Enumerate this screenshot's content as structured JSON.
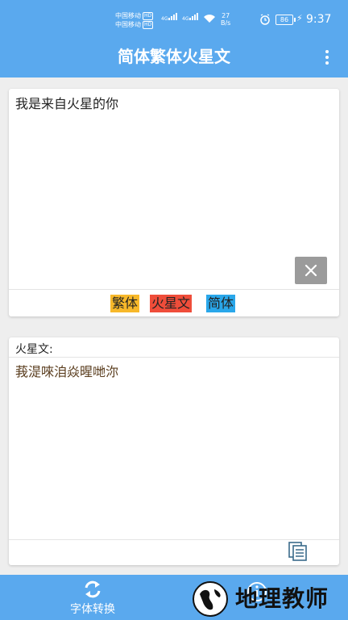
{
  "status_bar": {
    "carrier1": "中国移动",
    "carrier2": "中国移动",
    "hd": "HD",
    "network": "4G",
    "speed_value": "27",
    "speed_unit": "B/s",
    "battery": "86",
    "time": "9:37"
  },
  "app_bar": {
    "title": "简体繁体火星文",
    "menu_icon": "more-vertical-icon"
  },
  "input_card": {
    "text": "我是来自火星的你",
    "clear_icon": "close-icon",
    "buttons": [
      {
        "label": "繁体",
        "color": "#f7b82a"
      },
      {
        "label": "火星文",
        "color": "#ef4d3a"
      },
      {
        "label": "简体",
        "color": "#2aa7ea"
      }
    ]
  },
  "result_card": {
    "label": "火星文:",
    "text": "莪湜唻洎焱暒哋沵",
    "copy_icon": "copy-icon"
  },
  "bottom_nav": {
    "items": [
      {
        "label": "字体转换",
        "icon": "refresh-icon"
      },
      {
        "label": "",
        "icon": "info-icon"
      }
    ]
  },
  "watermark": {
    "text": "地理教师"
  },
  "colors": {
    "primary": "#5aa9ee",
    "result_text": "#5a3d1e"
  }
}
